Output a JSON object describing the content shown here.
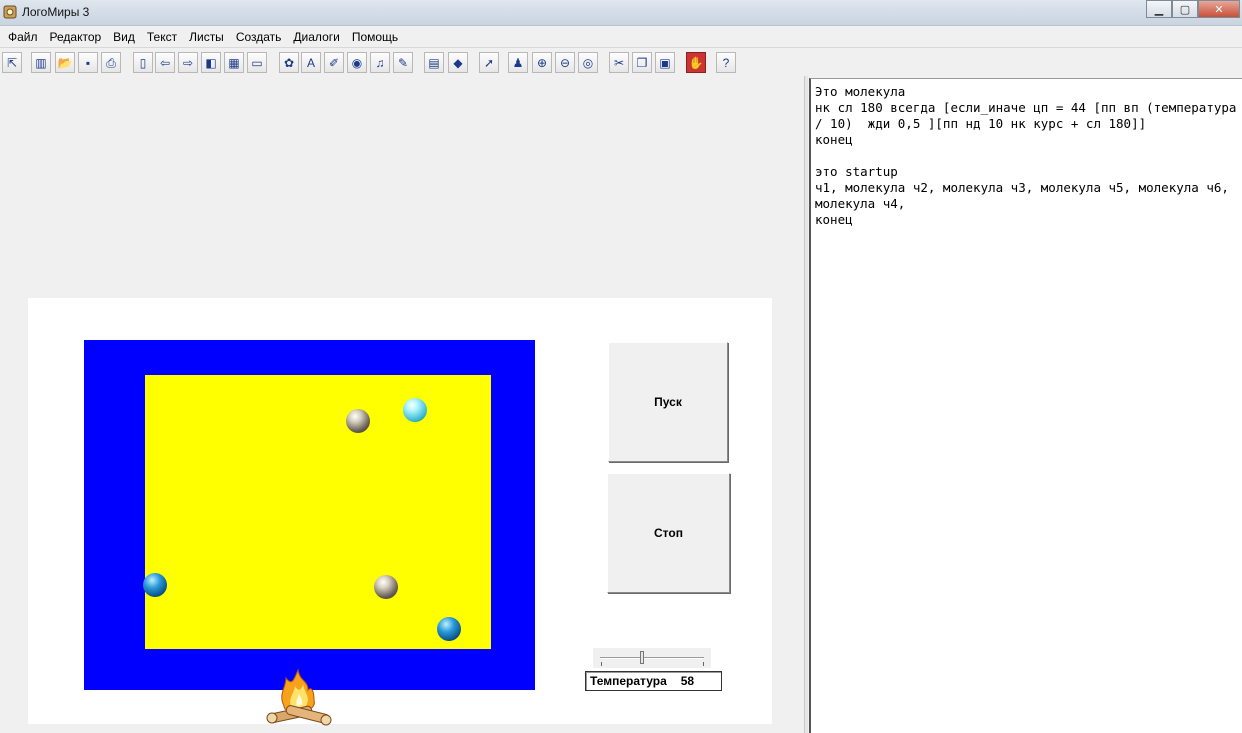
{
  "window": {
    "title": "ЛогоМиры 3"
  },
  "menu": [
    "Файл",
    "Редактор",
    "Вид",
    "Текст",
    "Листы",
    "Создать",
    "Диалоги",
    "Помощь"
  ],
  "toolbar": [
    {
      "name": "pointer-arrow-icon",
      "glyph": "⇱"
    },
    {
      "name": "calculator-icon",
      "glyph": "▥"
    },
    {
      "name": "open-folder-icon",
      "glyph": "📂"
    },
    {
      "name": "save-disk-icon",
      "glyph": "▪"
    },
    {
      "name": "print-icon",
      "glyph": "⎙"
    },
    {
      "name": "new-page-icon",
      "glyph": "▯"
    },
    {
      "name": "arrow-left-icon",
      "glyph": "⇦"
    },
    {
      "name": "arrow-right-icon",
      "glyph": "⇨"
    },
    {
      "name": "page-layout-icon",
      "glyph": "◧"
    },
    {
      "name": "grid-icon",
      "glyph": "▦"
    },
    {
      "name": "rectangle-icon",
      "glyph": "▭"
    },
    {
      "name": "turtle-icon",
      "glyph": "✿"
    },
    {
      "name": "text-box-icon",
      "glyph": "A"
    },
    {
      "name": "paint-brush-icon",
      "glyph": "✐"
    },
    {
      "name": "eye-mask-icon",
      "glyph": "◉"
    },
    {
      "name": "music-note-icon",
      "glyph": "♫"
    },
    {
      "name": "pen-icon",
      "glyph": "✎"
    },
    {
      "name": "clipboard-icon",
      "glyph": "▤"
    },
    {
      "name": "eraser-icon",
      "glyph": "◆"
    },
    {
      "name": "cursor-arrow-icon",
      "glyph": "➚"
    },
    {
      "name": "stamp-icon",
      "glyph": "♟"
    },
    {
      "name": "zoom-in-icon",
      "glyph": "⊕"
    },
    {
      "name": "zoom-out-icon",
      "glyph": "⊖"
    },
    {
      "name": "eye-icon",
      "glyph": "◎"
    },
    {
      "name": "scissors-icon",
      "glyph": "✂"
    },
    {
      "name": "copy-icon",
      "glyph": "❐"
    },
    {
      "name": "paste-icon",
      "glyph": "▣"
    },
    {
      "name": "stop-hand-icon",
      "glyph": "✋"
    },
    {
      "name": "help-icon",
      "glyph": "?"
    }
  ],
  "buttons": {
    "start": "Пуск",
    "stop": "Стоп"
  },
  "slider": {
    "label": "Температура",
    "value": "58"
  },
  "code": "Это молекула\nнк сл 180 всегда [если_иначе цп = 44 [пп вп (температура / 10)  жди 0,5 ][пп нд 10 нк курс + сл 180]]\nконец\n\nэто startup\nч1, молекула ч2, молекула ч3, молекула ч5, молекула ч6, молекула ч4,\nконец"
}
